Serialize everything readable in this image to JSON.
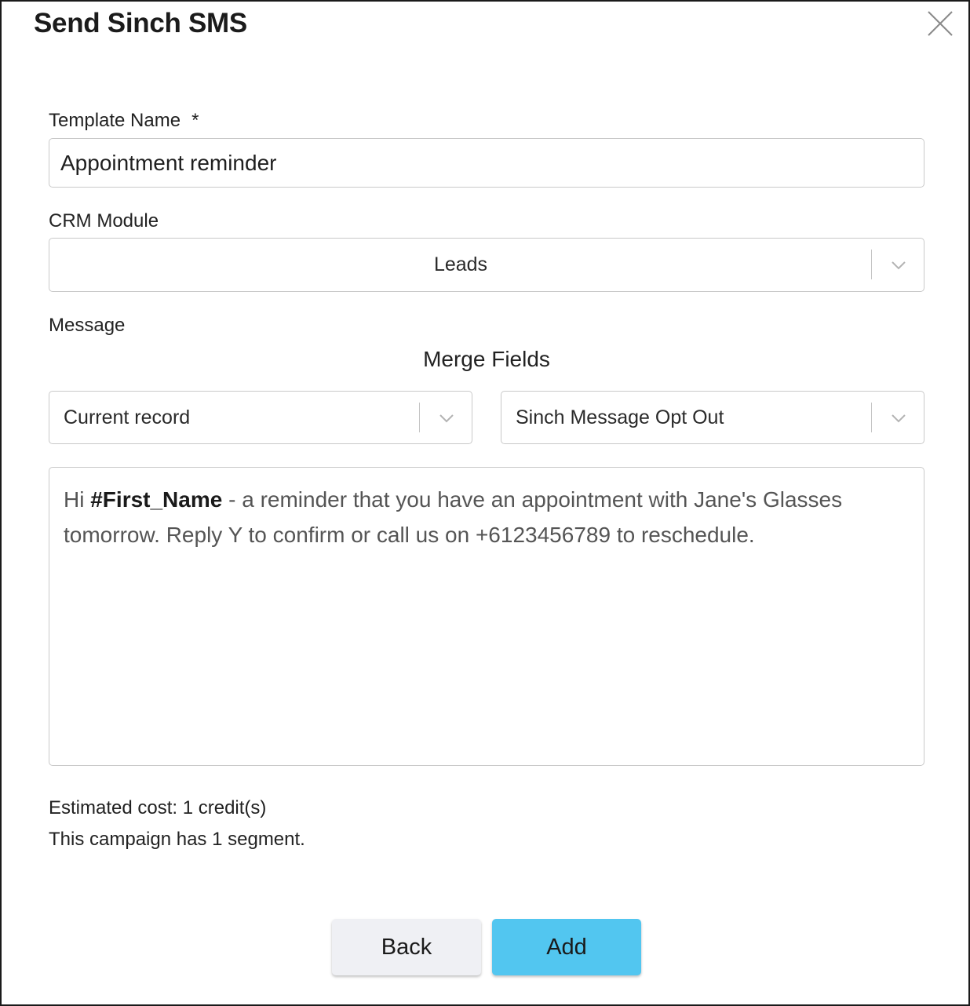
{
  "dialog": {
    "title": "Send Sinch SMS",
    "close_icon": "close-icon"
  },
  "template_name": {
    "label": "Template Name",
    "required_mark": "*",
    "value": "Appointment reminder"
  },
  "crm_module": {
    "label": "CRM Module",
    "selected": "Leads"
  },
  "message": {
    "label": "Message",
    "merge_fields_title": "Merge Fields",
    "record_select": "Current record",
    "field_select": "Sinch Message Opt Out",
    "body_prefix": "Hi ",
    "body_merge_field": "#First_Name",
    "body_rest": " - a reminder that you have an appointment with Jane's Glasses tomorrow. Reply Y to confirm or call us on +6123456789 to reschedule."
  },
  "estimates": {
    "cost": "Estimated cost: 1 credit(s)",
    "segments": "This campaign has 1 segment."
  },
  "buttons": {
    "back": "Back",
    "add": "Add"
  },
  "colors": {
    "add_button": "#52c6f0",
    "back_button": "#eff0f4",
    "border": "#c9c9c9"
  }
}
